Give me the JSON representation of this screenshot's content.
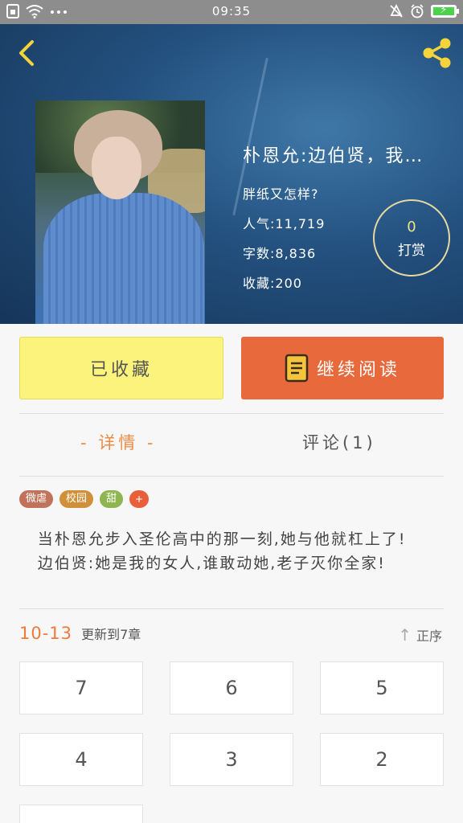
{
  "status_bar": {
    "time": "09:35",
    "icons_left": [
      "sim-icon",
      "wifi-icon",
      "more-dots-icon"
    ],
    "icons_right": [
      "mute-icon",
      "alarm-icon",
      "battery-charging-icon"
    ],
    "battery_color": "#4cd24c"
  },
  "header": {
    "back_icon": "chevron-left-icon",
    "share_icon": "share-icon",
    "accent_color": "#f5d33a"
  },
  "book": {
    "title": "朴恩允:边伯贤，我…",
    "author": "胖纸又怎样?",
    "popularity": "人气:11,719",
    "word_count": "字数:8,836",
    "favorites": "收藏:200"
  },
  "tip": {
    "count": "0",
    "label": "打赏"
  },
  "actions": {
    "collected_label": "已收藏",
    "read_label": "继续阅读",
    "collected_color": "#fbf37b",
    "read_color": "#e86a3c"
  },
  "tabs": {
    "detail": "- 详情 -",
    "comments": "评论(1)"
  },
  "tags": [
    {
      "label": "微虐",
      "color": "#c0735a"
    },
    {
      "label": "校园",
      "color": "#d0903a"
    },
    {
      "label": "甜",
      "color": "#8fb550"
    },
    {
      "label": "+",
      "color": "#e8603a"
    }
  ],
  "synopsis": [
    "当朴恩允步入圣伦高中的那一刻,她与他就杠上了!",
    "边伯贤:她是我的女人,谁敢动她,老子灭你全家!"
  ],
  "update": {
    "date": "10-13",
    "text": "更新到7章",
    "order_label": "正序"
  },
  "chapters": [
    "7",
    "6",
    "5",
    "4",
    "3",
    "2",
    ""
  ]
}
